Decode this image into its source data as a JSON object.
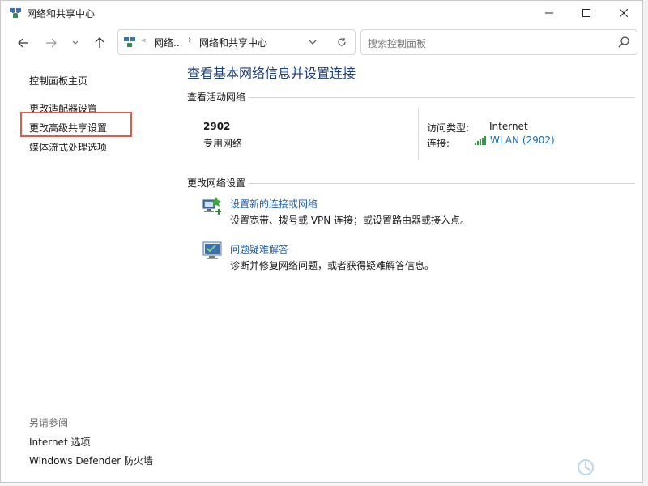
{
  "window": {
    "title": "网络和共享中心",
    "controls": {
      "minimize": "minimize-icon",
      "maximize": "maximize-icon",
      "close": "close-icon"
    }
  },
  "nav": {
    "back_icon": "arrow-left-icon",
    "forward_icon": "arrow-right-icon",
    "recent_icon": "chevron-down-icon",
    "up_icon": "arrow-up-icon",
    "address": {
      "overflow": "«",
      "crumb1": "网络...",
      "separator": "›",
      "crumb2": "网络和共享中心"
    },
    "search": {
      "placeholder": "搜索控制面板"
    }
  },
  "left_pane": {
    "home": "控制面板主页",
    "adapter_settings": "更改适配器设置",
    "advanced_sharing": "更改高级共享设置",
    "media_streaming": "媒体流式处理选项",
    "see_also": "另请参阅",
    "internet_options": "Internet 选项",
    "firewall": "Windows Defender 防火墙",
    "highlight_color": "#e05a47"
  },
  "main": {
    "title": "查看基本网络信息并设置连接",
    "active_networks_heading": "查看活动网络",
    "network_name": "2902",
    "network_type": "专用网络",
    "access_type_label": "访问类型:",
    "access_type_value": "Internet",
    "connection_label": "连接:",
    "connection_value": "WLAN (2902)",
    "change_settings_heading": "更改网络设置",
    "tasks": [
      {
        "icon": "network-setup-icon",
        "title": "设置新的连接或网络",
        "desc": "设置宽带、拨号或 VPN 连接；或设置路由器或接入点。"
      },
      {
        "icon": "troubleshoot-icon",
        "title": "问题疑难解答",
        "desc": "诊断并修复网络问题，或者获得疑难解答信息。"
      }
    ],
    "link_color": "#1f5ca8",
    "title_color": "#1e3f7a"
  }
}
